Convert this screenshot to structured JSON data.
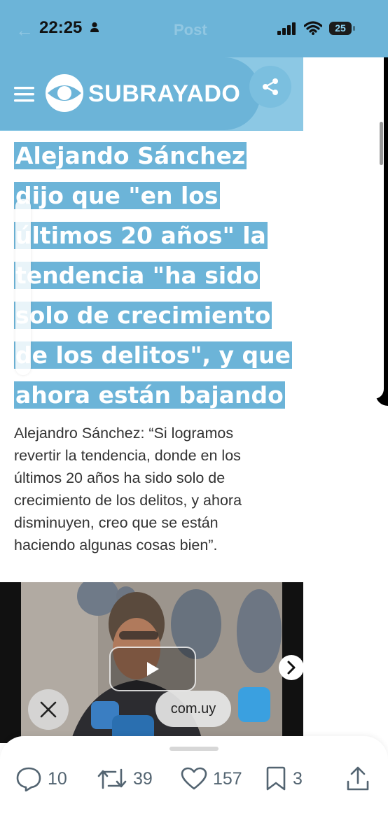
{
  "status_bar": {
    "time": "22:25",
    "battery": "25",
    "background_title": "Post"
  },
  "header": {
    "logo_text": "SUBRAYADO",
    "accent_color": "#6cb4d8"
  },
  "article": {
    "headline_lines": [
      " Alejando Sánchez",
      "dijo que \"en los",
      "últimos 20 años\" la",
      "tendencia \"ha sido",
      "solo de crecimiento",
      "de los delitos\", y que",
      "ahora están bajando"
    ],
    "body": "Alejandro Sánchez: “Si logramos revertir la tendencia, donde en los últimos 20 años ha sido solo de crecimiento de los delitos, y ahora disminuyen, creo que se están haciendo algunas cosas bien”."
  },
  "video": {
    "url_label": "com.uy"
  },
  "actions": {
    "replies": "10",
    "reposts": "39",
    "likes": "157",
    "bookmarks": "3"
  }
}
